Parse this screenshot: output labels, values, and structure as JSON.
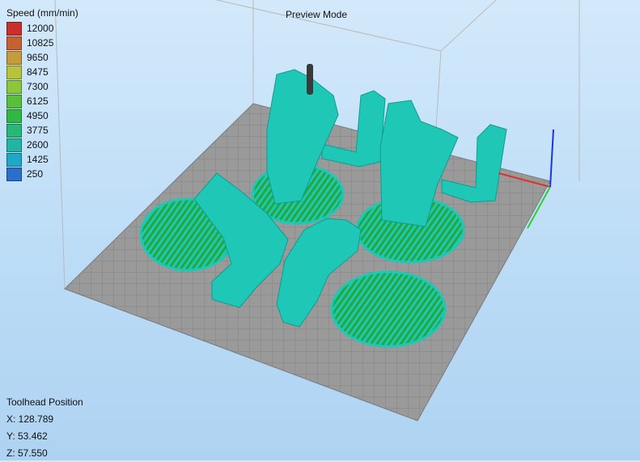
{
  "legend": {
    "title": "Speed (mm/min)",
    "items": [
      {
        "label": "12000",
        "color": "#c9302c"
      },
      {
        "label": "10825",
        "color": "#c6622f"
      },
      {
        "label": "9650",
        "color": "#c79a3a"
      },
      {
        "label": "8475",
        "color": "#b8c23a"
      },
      {
        "label": "7300",
        "color": "#8cc63c"
      },
      {
        "label": "6125",
        "color": "#58bf3c"
      },
      {
        "label": "4950",
        "color": "#2fb944"
      },
      {
        "label": "3775",
        "color": "#27b777"
      },
      {
        "label": "2600",
        "color": "#23b5a3"
      },
      {
        "label": "1425",
        "color": "#1ea7c8"
      },
      {
        "label": "250",
        "color": "#2a6fc9"
      }
    ]
  },
  "view": {
    "title": "Preview Mode"
  },
  "toolhead": {
    "title": "Toolhead Position",
    "x": "X: 128.789",
    "y": "Y: 53.462",
    "z": "Z: 57.550"
  },
  "colors": {
    "part": "#1fc7b7",
    "infill": "#23a83a",
    "bed": "#9c9c9c",
    "axis_x": "#e0302a",
    "axis_y": "#2ad12a",
    "axis_z": "#1a37d6"
  }
}
